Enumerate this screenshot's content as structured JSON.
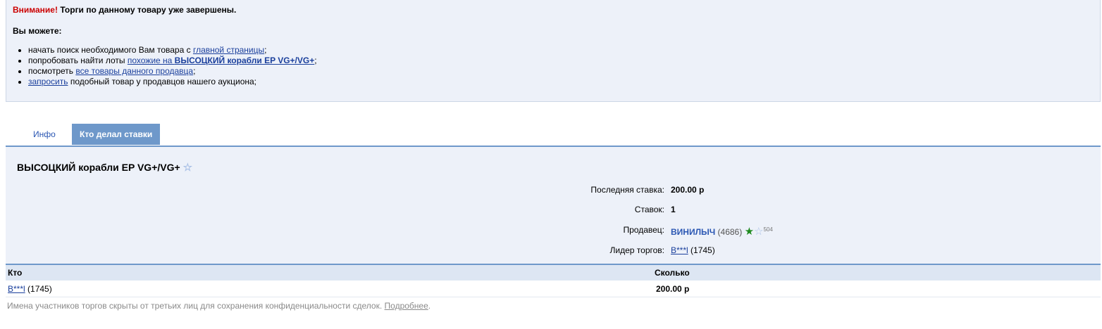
{
  "notice": {
    "warning_label": "Внимание!",
    "warning_text": "Торги по данному товару уже завершены.",
    "you_can": "Вы можете:",
    "items": [
      {
        "prefix": "начать поиск необходимого Вам товара с ",
        "link": "главной страницы",
        "suffix": ";"
      },
      {
        "prefix": "попробовать найти лоты ",
        "link": "похожие на ",
        "link_bold": "ВЫСОЦКИЙ корабли EP VG+/VG+",
        "suffix": ";"
      },
      {
        "prefix": "посмотреть ",
        "link": "все товары данного продавца",
        "suffix": ";"
      },
      {
        "prefix": "",
        "link": "запросить",
        "suffix": " подобный товар у продавцов нашего аукциона;"
      }
    ]
  },
  "tabs": [
    {
      "label": "Инфо",
      "active": false
    },
    {
      "label": "Кто делал ставки",
      "active": true
    }
  ],
  "lot": {
    "title": "ВЫСОЦКИЙ корабли EP VG+/VG+",
    "fields": {
      "last_bid_label": "Последняя ставка:",
      "last_bid_value": "200.00 р",
      "bids_label": "Ставок:",
      "bids_value": "1",
      "seller_label": "Продавец:",
      "seller_name": "ВИНИЛЫЧ",
      "seller_rating": "(4686)",
      "seller_small_count": "504",
      "leader_label": "Лидер торгов:",
      "leader_name": "В***l",
      "leader_rating": "(1745)"
    }
  },
  "bids_table": {
    "headers": [
      "Кто",
      "Сколько"
    ],
    "rows": [
      {
        "who": "В***l",
        "rating": "(1745)",
        "amount": "200.00 р"
      }
    ]
  },
  "footnote": {
    "text": "Имена участников торгов скрыты от третьих лиц для сохранения конфиденциальности сделок. ",
    "link": "Подробнее",
    "suffix": "."
  },
  "colors": {
    "accent": "#6e98ca",
    "panel_bg": "#edf1f9",
    "warning": "#cc0000",
    "link": "#1a3f9c",
    "green_star": "#1e8a1e"
  },
  "icons": {
    "favorite": "star-outline-icon",
    "seller_badge": "green-star-icon",
    "seller_badge2": "star-outline-icon"
  }
}
